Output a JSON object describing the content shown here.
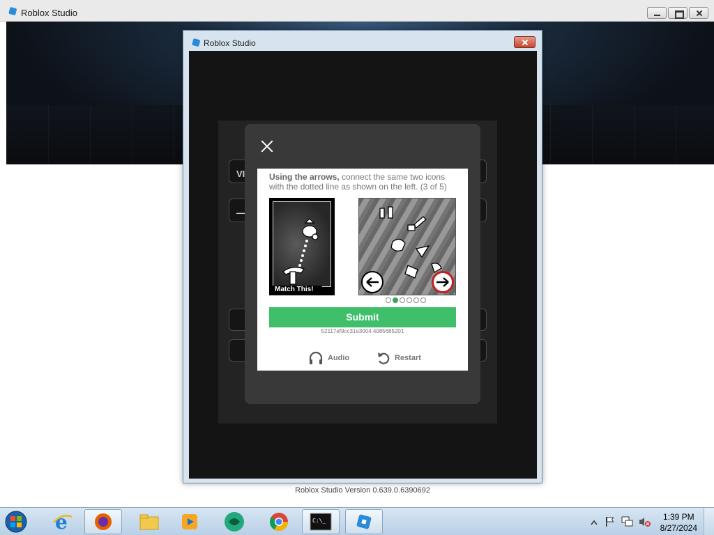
{
  "outer_window": {
    "title": "Roblox Studio"
  },
  "dialog": {
    "title": "Roblox Studio"
  },
  "background_form": {
    "field1_label": "VI",
    "field2_label": "—"
  },
  "captcha": {
    "instruction_bold": "Using the arrows,",
    "instruction_rest": " connect the same two icons with the dotted line as shown on the left. (3 of 5)",
    "match_label": "Match This!",
    "submit_label": "Submit",
    "session_id": "52117ef9cc31e3004.4085685201",
    "audio_label": "Audio",
    "restart_label": "Restart",
    "pages": 6,
    "active_page": 2,
    "accent_color": "#3fbf6a"
  },
  "version_text": "Roblox Studio Version 0.639.0.6390692",
  "taskbar": {
    "items": [
      "start-orb",
      "internet-explorer",
      "firefox",
      "file-explorer",
      "media-player",
      "mint-browser",
      "chrome",
      "command-prompt",
      "roblox-studio"
    ],
    "clock_time": "1:39 PM",
    "clock_date": "8/27/2024"
  }
}
